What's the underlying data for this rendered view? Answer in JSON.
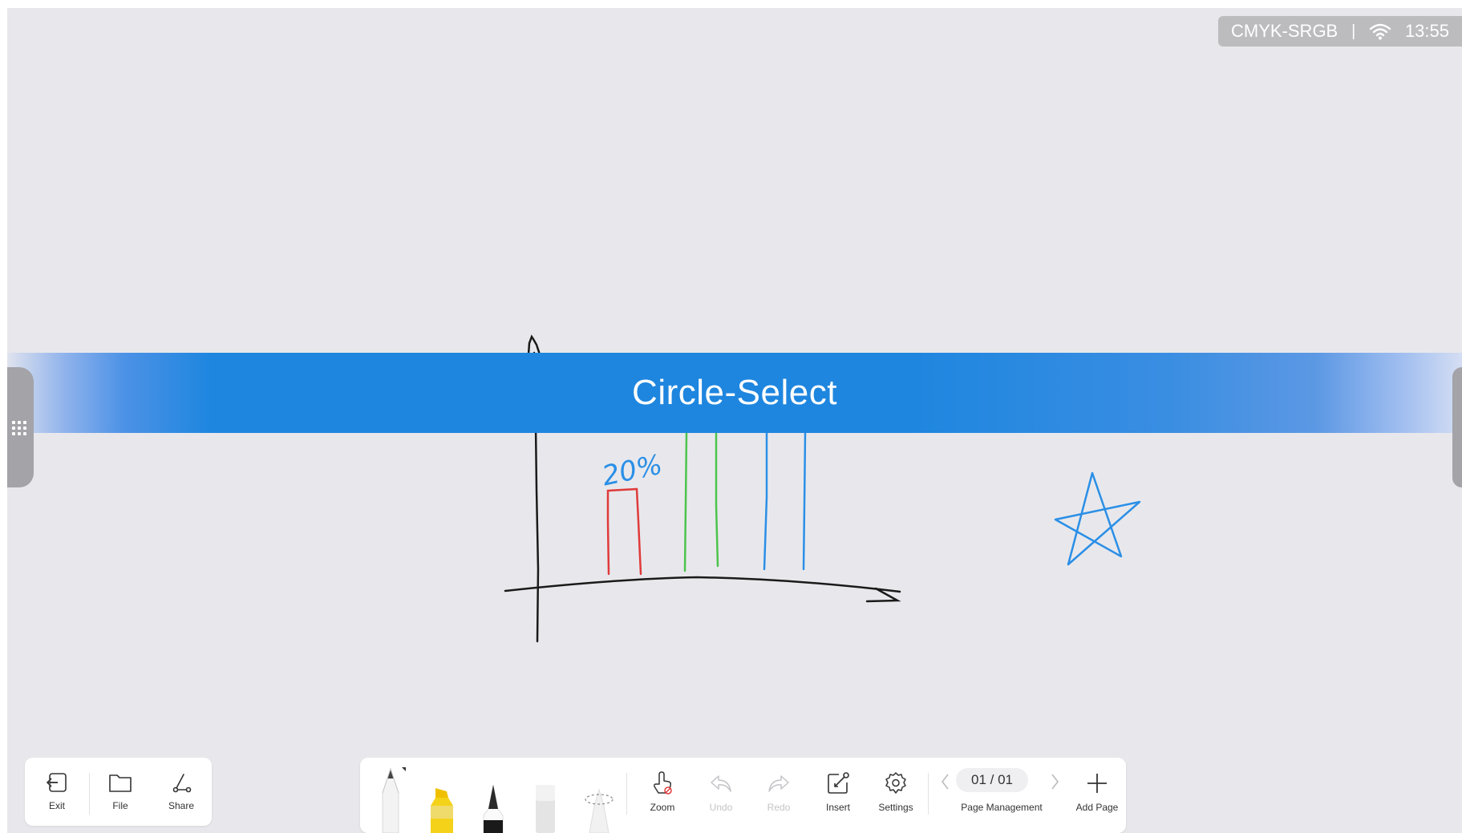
{
  "status_bar": {
    "color_mode": "CMYK-SRGB",
    "separator": "|",
    "time": "13:55",
    "wifi_icon": "wifi-icon"
  },
  "canvas": {
    "banner_text": "Circle-Select",
    "annotation_text": "20%",
    "drawing_colors": {
      "axes": "#1a1a1a",
      "red_bar": "#e03a3a",
      "green_bar": "#4cc44c",
      "blue_bar": "#2b8fe6",
      "star": "#2b8fe6"
    }
  },
  "left_toolbar": {
    "items": [
      {
        "label": "Exit",
        "icon": "exit-icon"
      },
      {
        "label": "File",
        "icon": "folder-icon"
      },
      {
        "label": "Share",
        "icon": "share-icon"
      }
    ]
  },
  "main_toolbar": {
    "pens": [
      "pencil",
      "highlighter",
      "fountain-pen",
      "eraser",
      "lasso"
    ],
    "tools": [
      {
        "label": "Zoom",
        "icon": "zoom-gesture-icon",
        "enabled": true
      },
      {
        "label": "Undo",
        "icon": "undo-icon",
        "enabled": false
      },
      {
        "label": "Redo",
        "icon": "redo-icon",
        "enabled": false
      },
      {
        "label": "Insert",
        "icon": "insert-icon",
        "enabled": true
      },
      {
        "label": "Settings",
        "icon": "gear-icon",
        "enabled": true
      }
    ],
    "page": {
      "current": "01 / 01",
      "label": "Page Management"
    },
    "add_page_label": "Add Page"
  },
  "colors": {
    "background": "#e8e8ec",
    "banner": "#1e86df",
    "status_pill": "#bcbcbf",
    "highlighter_yellow": "#f4d21a"
  }
}
